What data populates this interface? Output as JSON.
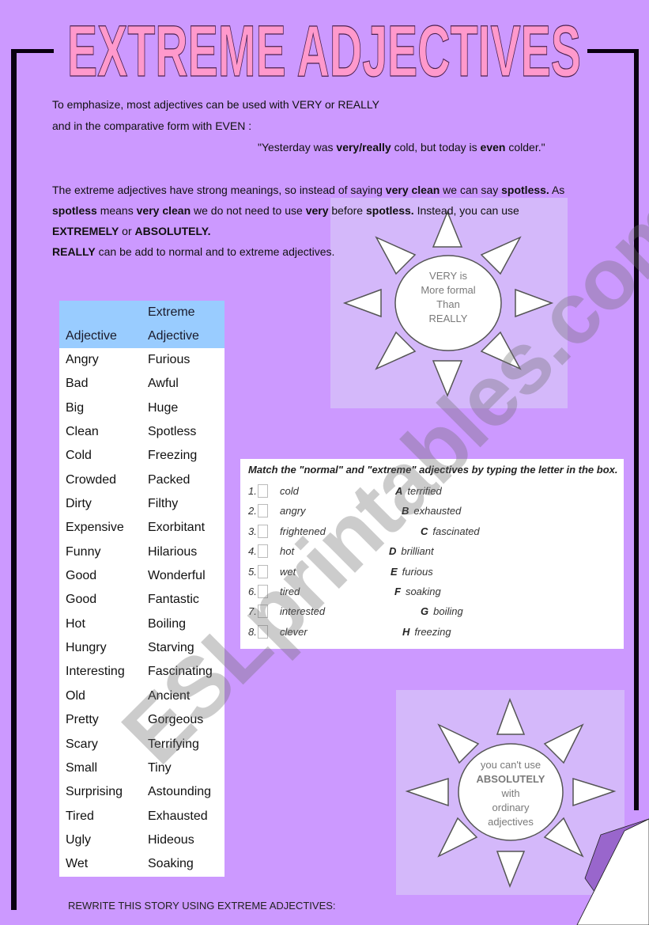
{
  "title": "EXTREME ADJECTIVES",
  "intro": {
    "line1": "To emphasize, most adjectives can be used with VERY or REALLY",
    "line2": "and in the comparative form with EVEN :",
    "example_pre": "\"Yesterday was ",
    "example_b1": "very/really",
    "example_mid": " cold, but today is ",
    "example_b2": "even",
    "example_post": " colder.\"",
    "p2_a": "The extreme adjectives have strong meanings, so instead of saying ",
    "p2_b1": "very clean",
    "p2_c": " we can say ",
    "p2_b2": "spotless.",
    "p2_d": " As",
    "p3_b1": "spotless",
    "p3_a": " means ",
    "p3_b2": "very clean",
    "p3_c": " we do not need to use ",
    "p3_b3": "very",
    "p3_d": " before ",
    "p3_b4": "spotless.",
    "p3_e": " Instead, you can use",
    "p4_b1": "EXTREMELY",
    "p4_a": " or ",
    "p4_b2": "ABSOLUTELY.",
    "p5_b1": "REALLY",
    "p5_a": " can be add to normal and to extreme adjectives."
  },
  "sun1": {
    "lines": [
      "VERY is",
      "More formal",
      "Than",
      "REALLY"
    ]
  },
  "sun2": {
    "lines": [
      "you can't use",
      "ABSOLUTELY",
      "with",
      "ordinary",
      "adjectives"
    ]
  },
  "table": {
    "header": {
      "col1": "Adjective",
      "col2_line1": "Extreme",
      "col2_line2": "Adjective"
    },
    "rows": [
      {
        "normal": "Angry",
        "extreme": "Furious"
      },
      {
        "normal": "Bad",
        "extreme": "Awful"
      },
      {
        "normal": "Big",
        "extreme": "Huge"
      },
      {
        "normal": "Clean",
        "extreme": "Spotless"
      },
      {
        "normal": "Cold",
        "extreme": "Freezing"
      },
      {
        "normal": "Crowded",
        "extreme": "Packed"
      },
      {
        "normal": "Dirty",
        "extreme": "Filthy"
      },
      {
        "normal": "Expensive",
        "extreme": "Exorbitant"
      },
      {
        "normal": "Funny",
        "extreme": "Hilarious"
      },
      {
        "normal": "Good",
        "extreme": "Wonderful"
      },
      {
        "normal": "Good",
        "extreme": "Fantastic"
      },
      {
        "normal": "Hot",
        "extreme": "Boiling"
      },
      {
        "normal": "Hungry",
        "extreme": "Starving"
      },
      {
        "normal": "Interesting",
        "extreme": "Fascinating"
      },
      {
        "normal": "Old",
        "extreme": "Ancient"
      },
      {
        "normal": "Pretty",
        "extreme": "Gorgeous"
      },
      {
        "normal": "Scary",
        "extreme": "Terrifying"
      },
      {
        "normal": "Small",
        "extreme": "Tiny"
      },
      {
        "normal": "Surprising",
        "extreme": "Astounding"
      },
      {
        "normal": "Tired",
        "extreme": "Exhausted"
      },
      {
        "normal": "Ugly",
        "extreme": "Hideous"
      },
      {
        "normal": "Wet",
        "extreme": "Soaking"
      }
    ]
  },
  "match": {
    "instruction": "Match the \"normal\" and \"extreme\" adjectives by typing the letter in the box.",
    "items": [
      {
        "num": "1.",
        "word": "cold",
        "answer": ""
      },
      {
        "num": "2.",
        "word": "angry",
        "answer": ""
      },
      {
        "num": "3.",
        "word": "frightened",
        "answer": ""
      },
      {
        "num": "4.",
        "word": "hot",
        "answer": ""
      },
      {
        "num": "5.",
        "word": "wet",
        "answer": ""
      },
      {
        "num": "6.",
        "word": "tired",
        "answer": ""
      },
      {
        "num": "7.",
        "word": "interested",
        "answer": ""
      },
      {
        "num": "8.",
        "word": "clever",
        "answer": ""
      }
    ],
    "options": [
      {
        "letter": "A",
        "word": "terrified"
      },
      {
        "letter": "B",
        "word": "exhausted"
      },
      {
        "letter": "C",
        "word": "fascinated"
      },
      {
        "letter": "D",
        "word": "brilliant"
      },
      {
        "letter": "E",
        "word": "furious"
      },
      {
        "letter": "F",
        "word": "soaking"
      },
      {
        "letter": "G",
        "word": "boiling"
      },
      {
        "letter": "H",
        "word": "freezing"
      }
    ]
  },
  "footer": {
    "rewrite": "REWRITE THIS STORY USING EXTREME ADJECTIVES:"
  },
  "watermark": "ESLprintables.com",
  "colors": {
    "page_bg": "#cc99ff",
    "panel_bg": "#d4b8fa",
    "title_fill": "#ff99cc",
    "table_header": "#99ccff"
  }
}
